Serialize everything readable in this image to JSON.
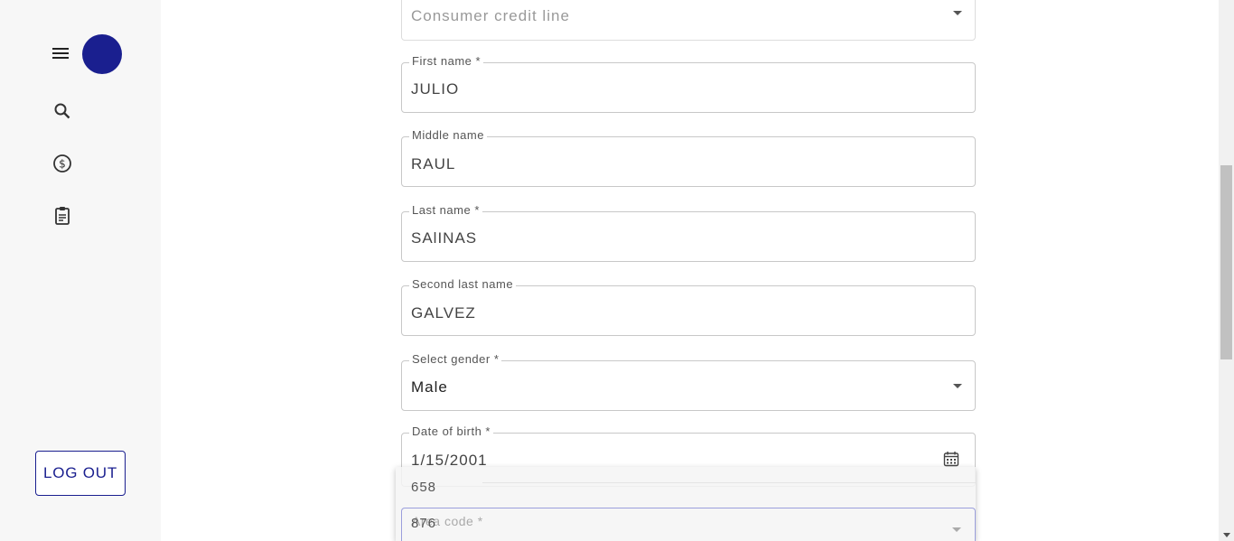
{
  "sidebar": {
    "icons": [
      "menu-icon",
      "search-icon",
      "dollar-icon",
      "clipboard-icon"
    ],
    "logout_label": "LOG OUT",
    "avatar_color": "#1a1f8f"
  },
  "form": {
    "credit_line": {
      "value": "Consumer credit line"
    },
    "first_name": {
      "label": "First name *",
      "value": "JULIO"
    },
    "middle_name": {
      "label": "Middle name",
      "value": "RAUL"
    },
    "last_name": {
      "label": "Last name *",
      "value": "SAlINAS"
    },
    "second_last_name": {
      "label": "Second last name",
      "value": "GALVEZ"
    },
    "gender": {
      "label": "Select gender *",
      "value": "Male"
    },
    "dob": {
      "label": "Date of birth *",
      "value": "1/15/2001"
    },
    "area_code": {
      "label": "Area code *"
    }
  },
  "dropdown": {
    "options": [
      "658",
      "876"
    ]
  }
}
